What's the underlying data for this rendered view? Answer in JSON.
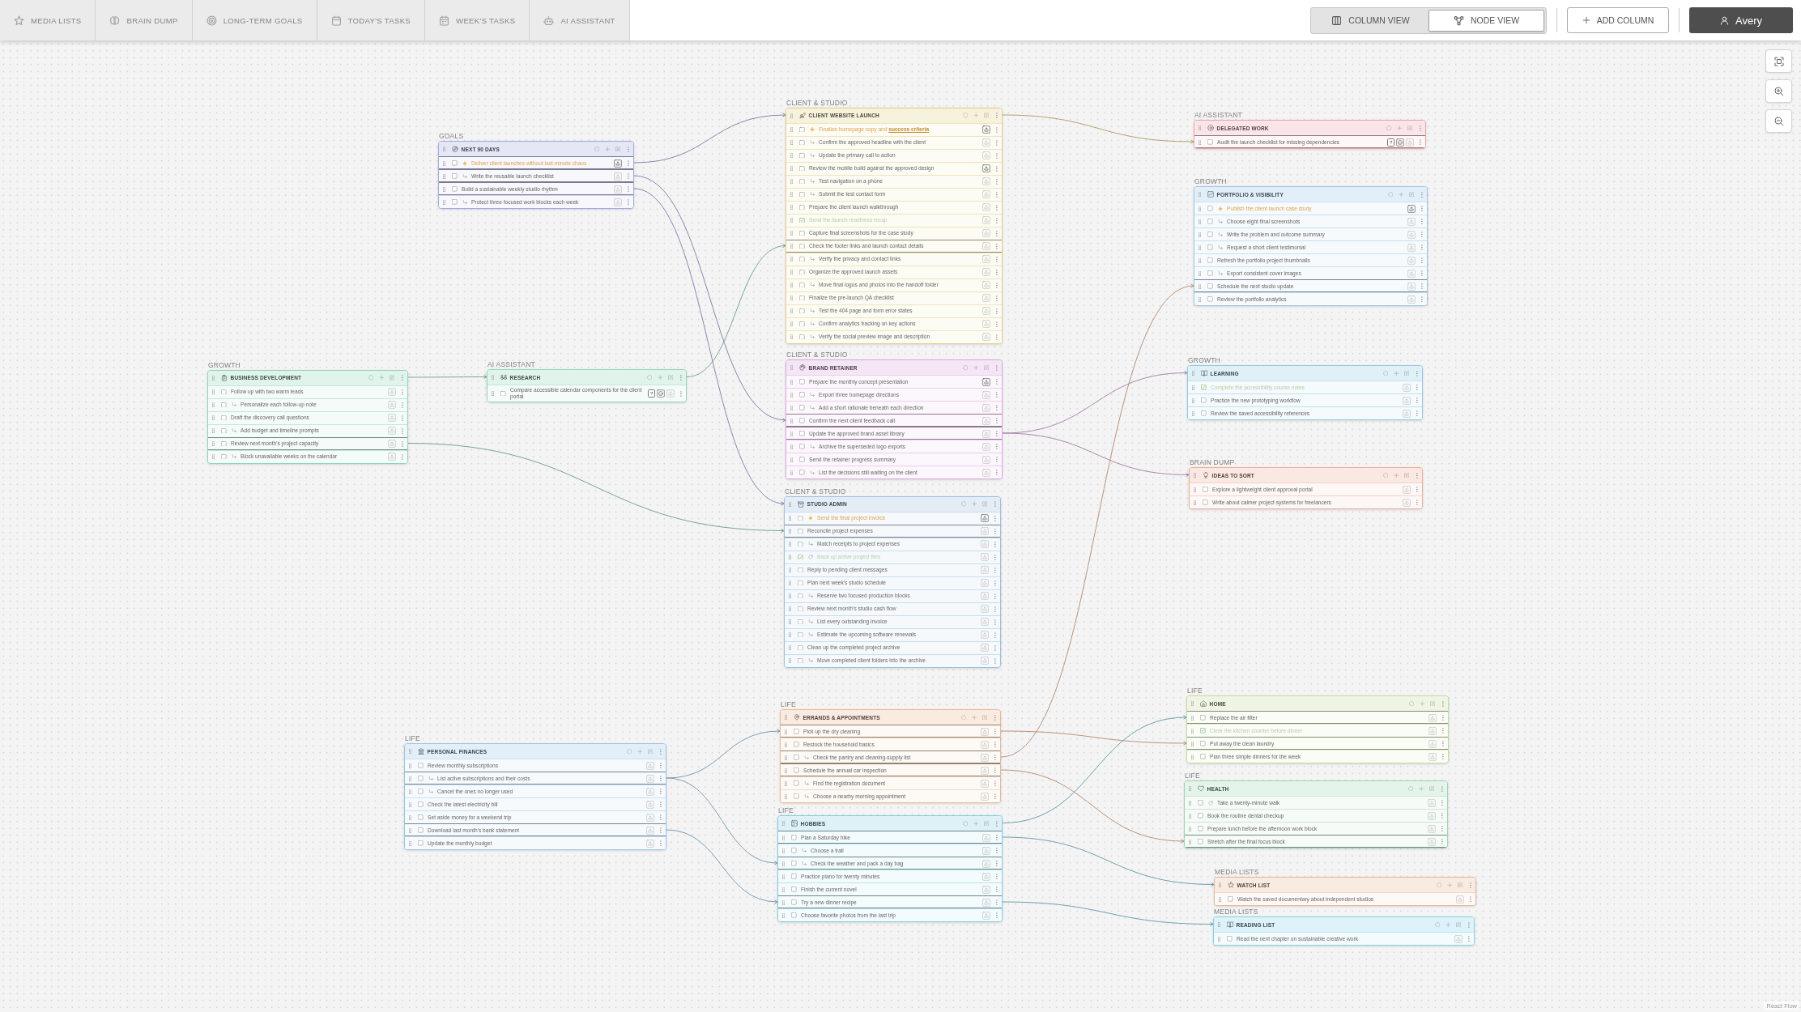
{
  "tabs": [
    {
      "label": "MEDIA LISTS",
      "selected": false
    },
    {
      "label": "BRAIN DUMP",
      "selected": false
    },
    {
      "label": "LONG-TERM GOALS",
      "selected": false
    },
    {
      "label": "TODAY'S TASKS",
      "selected": false
    },
    {
      "label": "WEEK'S TASKS",
      "selected": false
    },
    {
      "label": "AI ASSISTANT",
      "selected": false
    }
  ],
  "views": [
    {
      "label": "COLUMN VIEW",
      "selected": false
    },
    {
      "label": "NODE VIEW",
      "selected": true
    }
  ],
  "add_column": "ADD COLUMN",
  "user": "Avery",
  "nodes": [
    {
      "group": "CLIENT & STUDIO",
      "title": "CLIENT WEBSITE LAUNCH",
      "color": "#e3cf86",
      "items": [
        {
          "text": "Finalize homepage copy and **success criteria**",
          "checked": false,
          "priority": true,
          "scheduled": true,
          "recurring": false,
          "children": [
            {
              "text": "Confirm the approved headline with the client",
              "checked": false,
              "priority": false,
              "scheduled": false,
              "recurring": false
            },
            {
              "text": "Update the primary call to action",
              "checked": false,
              "priority": false,
              "scheduled": false,
              "recurring": false
            }
          ]
        },
        {
          "text": "Review the mobile build against the approved design",
          "checked": false,
          "priority": false,
          "scheduled": true,
          "recurring": false,
          "children": [
            {
              "text": "Test navigation on a phone",
              "checked": false,
              "priority": false,
              "scheduled": false,
              "recurring": false
            },
            {
              "text": "Submit the test contact form",
              "checked": false,
              "priority": false,
              "scheduled": false,
              "recurring": false
            }
          ]
        },
        {
          "text": "Prepare the client launch walkthrough",
          "checked": false,
          "priority": false,
          "scheduled": false,
          "recurring": false
        },
        {
          "text": "Send the launch readiness recap",
          "checked": true,
          "priority": false,
          "scheduled": false,
          "recurring": false
        },
        {
          "text": "Capture final screenshots for the case study",
          "checked": false,
          "priority": false,
          "scheduled": false,
          "recurring": false
        },
        {
          "text": "Check the footer links and launch contact details",
          "checked": false,
          "priority": false,
          "scheduled": false,
          "recurring": false,
          "children": [
            {
              "text": "Verify the privacy and contact links",
              "checked": false,
              "priority": false,
              "scheduled": false,
              "recurring": false
            }
          ]
        },
        {
          "text": "Organize the approved launch assets",
          "checked": false,
          "priority": false,
          "scheduled": false,
          "recurring": false,
          "children": [
            {
              "text": "Move final logos and photos into the handoff folder",
              "checked": false,
              "priority": false,
              "scheduled": false,
              "recurring": false
            }
          ]
        },
        {
          "text": "Finalize the pre-launch QA checklist",
          "checked": false,
          "priority": false,
          "scheduled": false,
          "recurring": false,
          "children": [
            {
              "text": "Test the 404 page and form error states",
              "checked": false,
              "priority": false,
              "scheduled": false,
              "recurring": false
            },
            {
              "text": "Confirm analytics tracking on key actions",
              "checked": false,
              "priority": false,
              "scheduled": false,
              "recurring": false
            },
            {
              "text": "Verify the social preview image and description",
              "checked": false,
              "priority": false,
              "scheduled": false,
              "recurring": false
            }
          ]
        }
      ]
    },
    {
      "group": "AI ASSISTANT",
      "title": "DELEGATED WORK",
      "color": "#eea3ad",
      "items": [
        {
          "text": "Audit the launch checklist for missing dependencies",
          "checked": false,
          "priority": false,
          "scheduled": false,
          "recurring": false,
          "help": "?"
        }
      ]
    },
    {
      "group": "GOALS",
      "title": "NEXT 90 DAYS",
      "color": "#a3abe0",
      "items": [
        {
          "text": "Deliver client launches without last-minute chaos",
          "checked": false,
          "priority": true,
          "scheduled": true,
          "recurring": false,
          "children": [
            {
              "text": "Write the reusable launch checklist",
              "checked": false,
              "priority": false,
              "scheduled": false,
              "recurring": false
            }
          ]
        },
        {
          "text": "Build a sustainable weekly studio rhythm",
          "checked": false,
          "priority": false,
          "scheduled": false,
          "recurring": false,
          "children": [
            {
              "text": "Protect three focused work blocks each week",
              "checked": false,
              "priority": false,
              "scheduled": false,
              "recurring": false
            }
          ]
        }
      ]
    },
    {
      "group": "GROWTH",
      "title": "PORTFOLIO & VISIBILITY",
      "color": "#9cc6e6",
      "items": [
        {
          "text": "Publish the client launch case study",
          "checked": false,
          "priority": true,
          "scheduled": true,
          "recurring": false,
          "children": [
            {
              "text": "Choose eight final screenshots",
              "checked": false,
              "priority": false,
              "scheduled": false,
              "recurring": false
            },
            {
              "text": "Write the problem and outcome summary",
              "checked": false,
              "priority": false,
              "scheduled": false,
              "recurring": false
            },
            {
              "text": "Request a short client testimonial",
              "checked": false,
              "priority": false,
              "scheduled": false,
              "recurring": false
            }
          ]
        },
        {
          "text": "Refresh the portfolio project thumbnails",
          "checked": false,
          "priority": false,
          "scheduled": false,
          "recurring": false,
          "children": [
            {
              "text": "Export consistent cover images",
              "checked": false,
              "priority": false,
              "scheduled": false,
              "recurring": false
            }
          ]
        },
        {
          "text": "Schedule the next studio update",
          "checked": false,
          "priority": false,
          "scheduled": false,
          "recurring": false
        },
        {
          "text": "Review the portfolio analytics",
          "checked": false,
          "priority": false,
          "scheduled": false,
          "recurring": false
        }
      ]
    },
    {
      "group": "CLIENT & STUDIO",
      "title": "BRAND RETAINER",
      "color": "#dba6e0",
      "items": [
        {
          "text": "Prepare the monthly concept presentation",
          "checked": false,
          "priority": false,
          "scheduled": true,
          "recurring": false,
          "children": [
            {
              "text": "Export three homepage directions",
              "checked": false,
              "priority": false,
              "scheduled": false,
              "recurring": false
            },
            {
              "text": "Add a short rationale beneath each direction",
              "checked": false,
              "priority": false,
              "scheduled": false,
              "recurring": false
            }
          ]
        },
        {
          "text": "Confirm the next client feedback call",
          "checked": false,
          "priority": false,
          "scheduled": false,
          "recurring": false
        },
        {
          "text": "Update the approved brand asset library",
          "checked": false,
          "priority": false,
          "scheduled": false,
          "recurring": false,
          "children": [
            {
              "text": "Archive the superseded logo exports",
              "checked": false,
              "priority": false,
              "scheduled": false,
              "recurring": false
            }
          ]
        },
        {
          "text": "Send the retainer progress summary",
          "checked": false,
          "priority": false,
          "scheduled": false,
          "recurring": false,
          "children": [
            {
              "text": "List the decisions still waiting on the client",
              "checked": false,
              "priority": false,
              "scheduled": false,
              "recurring": false
            }
          ]
        }
      ]
    },
    {
      "group": "GROWTH",
      "title": "LEARNING",
      "color": "#8fc9e3",
      "items": [
        {
          "text": "Complete the accessibility course notes",
          "checked": true,
          "priority": false,
          "scheduled": false,
          "recurring": false
        },
        {
          "text": "Practice the new prototyping workflow",
          "checked": false,
          "priority": false,
          "scheduled": false,
          "recurring": false
        },
        {
          "text": "Review the saved accessibility references",
          "checked": false,
          "priority": false,
          "scheduled": false,
          "recurring": false
        }
      ]
    },
    {
      "group": "GROWTH",
      "title": "BUSINESS DEVELOPMENT",
      "color": "#8fd6bb",
      "items": [
        {
          "text": "Follow up with two warm leads",
          "checked": false,
          "priority": false,
          "scheduled": false,
          "recurring": false,
          "children": [
            {
              "text": "Personalize each follow-up note",
              "checked": false,
              "priority": false,
              "scheduled": false,
              "recurring": false
            }
          ]
        },
        {
          "text": "Draft the discovery call questions",
          "checked": false,
          "priority": false,
          "scheduled": false,
          "recurring": false,
          "children": [
            {
              "text": "Add budget and timeline prompts",
              "checked": false,
              "priority": false,
              "scheduled": false,
              "recurring": false
            }
          ]
        },
        {
          "text": "Review next month's project capacity",
          "checked": false,
          "priority": false,
          "scheduled": false,
          "recurring": false,
          "children": [
            {
              "text": "Block unavailable weeks on the calendar",
              "checked": false,
              "priority": false,
              "scheduled": false,
              "recurring": false
            }
          ]
        }
      ]
    },
    {
      "group": "AI ASSISTANT",
      "title": "RESEARCH",
      "color": "#8fd6bb",
      "items": [
        {
          "text": "Compare accessible calendar components for the client portal",
          "checked": false,
          "priority": false,
          "scheduled": false,
          "recurring": false,
          "help": "?"
        }
      ]
    },
    {
      "group": "BRAIN DUMP",
      "title": "IDEAS TO SORT",
      "color": "#eeac98",
      "items": [
        {
          "text": "Explore a lightweight client approval portal",
          "checked": false,
          "priority": false,
          "scheduled": false,
          "recurring": false
        },
        {
          "text": "Write about calmer project systems for freelancers",
          "checked": false,
          "priority": false,
          "scheduled": false,
          "recurring": false
        }
      ]
    },
    {
      "group": "CLIENT & STUDIO",
      "title": "STUDIO ADMIN",
      "color": "#9dbfe0",
      "items": [
        {
          "text": "Send the final project invoice",
          "checked": false,
          "priority": true,
          "scheduled": true,
          "recurring": false
        },
        {
          "text": "Reconcile project expenses",
          "checked": false,
          "priority": false,
          "scheduled": false,
          "recurring": false,
          "children": [
            {
              "text": "Match receipts to project expenses",
              "checked": false,
              "priority": false,
              "scheduled": false,
              "recurring": false
            }
          ]
        },
        {
          "text": "Back up active project files",
          "checked": true,
          "priority": false,
          "scheduled": false,
          "recurring": true
        },
        {
          "text": "Reply to pending client messages",
          "checked": false,
          "priority": false,
          "scheduled": false,
          "recurring": false
        },
        {
          "text": "Plan next week's studio schedule",
          "checked": false,
          "priority": false,
          "scheduled": false,
          "recurring": false,
          "children": [
            {
              "text": "Reserve two focused production blocks",
              "checked": false,
              "priority": false,
              "scheduled": false,
              "recurring": false
            }
          ]
        },
        {
          "text": "Review next month's studio cash flow",
          "checked": false,
          "priority": false,
          "scheduled": false,
          "recurring": false,
          "children": [
            {
              "text": "List every outstanding invoice",
              "checked": false,
              "priority": false,
              "scheduled": false,
              "recurring": false
            },
            {
              "text": "Estimate the upcoming software renewals",
              "checked": false,
              "priority": false,
              "scheduled": false,
              "recurring": false
            }
          ]
        },
        {
          "text": "Clean up the completed project archive",
          "checked": false,
          "priority": false,
          "scheduled": false,
          "recurring": false,
          "children": [
            {
              "text": "Move completed client folders into the archive",
              "checked": false,
              "priority": false,
              "scheduled": false,
              "recurring": false
            }
          ]
        }
      ]
    },
    {
      "group": "LIFE",
      "title": "HOME",
      "color": "#c5dba0",
      "items": [
        {
          "text": "Replace the air filter",
          "checked": false,
          "priority": false,
          "scheduled": false,
          "recurring": false
        },
        {
          "text": "Clear the kitchen counter before dinner",
          "checked": true,
          "priority": false,
          "scheduled": false,
          "recurring": false
        },
        {
          "text": "Put away the clean laundry",
          "checked": false,
          "priority": false,
          "scheduled": false,
          "recurring": false
        },
        {
          "text": "Plan three simple dinners for the week",
          "checked": false,
          "priority": false,
          "scheduled": false,
          "recurring": false
        }
      ]
    },
    {
      "group": "LIFE",
      "title": "ERRANDS & APPOINTMENTS",
      "color": "#eeb894",
      "items": [
        {
          "text": "Pick up the dry cleaning",
          "checked": false,
          "priority": false,
          "scheduled": false,
          "recurring": false
        },
        {
          "text": "Restock the household basics",
          "checked": false,
          "priority": false,
          "scheduled": false,
          "recurring": false,
          "children": [
            {
              "text": "Check the pantry and cleaning-supply list",
              "checked": false,
              "priority": false,
              "scheduled": false,
              "recurring": false
            }
          ]
        },
        {
          "text": "Schedule the annual car inspection",
          "checked": false,
          "priority": false,
          "scheduled": false,
          "recurring": false,
          "children": [
            {
              "text": "Find the registration document",
              "checked": false,
              "priority": false,
              "scheduled": false,
              "recurring": false
            },
            {
              "text": "Choose a nearby morning appointment",
              "checked": false,
              "priority": false,
              "scheduled": false,
              "recurring": false
            }
          ]
        }
      ]
    },
    {
      "group": "LIFE",
      "title": "PERSONAL FINANCES",
      "color": "#9cc6e6",
      "items": [
        {
          "text": "Review monthly subscriptions",
          "checked": false,
          "priority": false,
          "scheduled": false,
          "recurring": false,
          "children": [
            {
              "text": "List active subscriptions and their costs",
              "checked": false,
              "priority": false,
              "scheduled": false,
              "recurring": false
            },
            {
              "text": "Cancel the ones no longer used",
              "checked": false,
              "priority": false,
              "scheduled": false,
              "recurring": false
            }
          ]
        },
        {
          "text": "Check the latest electricity bill",
          "checked": false,
          "priority": false,
          "scheduled": false,
          "recurring": false
        },
        {
          "text": "Set aside money for a weekend trip",
          "checked": false,
          "priority": false,
          "scheduled": false,
          "recurring": false
        },
        {
          "text": "Download last month's bank statement",
          "checked": false,
          "priority": false,
          "scheduled": false,
          "recurring": false
        },
        {
          "text": "Update the monthly budget",
          "checked": false,
          "priority": false,
          "scheduled": false,
          "recurring": false
        }
      ]
    },
    {
      "group": "LIFE",
      "title": "HEALTH",
      "color": "#9dd6b4",
      "items": [
        {
          "text": "Take a twenty-minute walk",
          "checked": false,
          "priority": false,
          "scheduled": false,
          "recurring": true
        },
        {
          "text": "Book the routine dental checkup",
          "checked": false,
          "priority": false,
          "scheduled": false,
          "recurring": false
        },
        {
          "text": "Prepare lunch before the afternoon work block",
          "checked": false,
          "priority": false,
          "scheduled": false,
          "recurring": false
        },
        {
          "text": "Stretch after the final focus block",
          "checked": false,
          "priority": false,
          "scheduled": false,
          "recurring": false
        }
      ]
    },
    {
      "group": "LIFE",
      "title": "HOBBIES",
      "color": "#84cde0",
      "items": [
        {
          "text": "Plan a Saturday hike",
          "checked": false,
          "priority": false,
          "scheduled": false,
          "recurring": false,
          "children": [
            {
              "text": "Choose a trail",
              "checked": false,
              "priority": false,
              "scheduled": false,
              "recurring": false
            },
            {
              "text": "Check the weather and pack a day bag",
              "checked": false,
              "priority": false,
              "scheduled": false,
              "recurring": false
            }
          ]
        },
        {
          "text": "Practice piano for twenty minutes",
          "checked": false,
          "priority": false,
          "scheduled": false,
          "recurring": false
        },
        {
          "text": "Finish the current novel",
          "checked": false,
          "priority": false,
          "scheduled": false,
          "recurring": false
        },
        {
          "text": "Try a new dinner recipe",
          "checked": false,
          "priority": false,
          "scheduled": false,
          "recurring": false
        },
        {
          "text": "Choose favorite photos from the last trip",
          "checked": false,
          "priority": false,
          "scheduled": false,
          "recurring": false
        }
      ]
    },
    {
      "group": "MEDIA LISTS",
      "title": "WATCH LIST",
      "color": "#e6b898",
      "items": [
        {
          "text": "Watch the saved documentary about independent studios",
          "checked": false,
          "priority": false,
          "scheduled": false,
          "recurring": false
        }
      ]
    },
    {
      "group": "MEDIA LISTS",
      "title": "READING LIST",
      "color": "#84d2e8",
      "items": [
        {
          "text": "Read the next chapter on sustainable creative work",
          "checked": false,
          "priority": false,
          "scheduled": false,
          "recurring": false
        }
      ]
    }
  ],
  "attribution": "React Flow"
}
